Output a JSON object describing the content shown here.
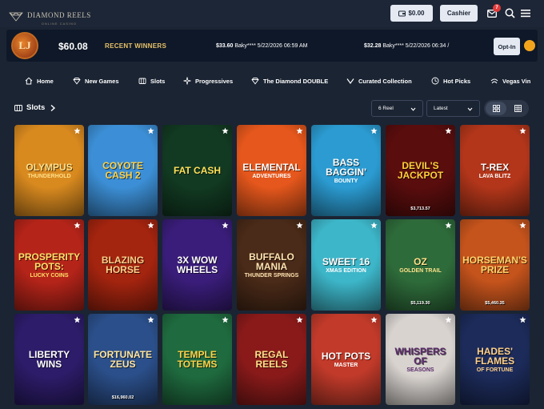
{
  "header": {
    "logo_text": "DIAMOND REELS",
    "logo_subtext": "ONLINE CASINO",
    "balance": "$0.00",
    "cashier_label": "Cashier",
    "notifications_count": "7",
    "bg_color": "#1d2636"
  },
  "banner": {
    "logo_text": "LJ",
    "jackpot_amount": "$60.08",
    "recent_label": "RECENT WINNERS",
    "winners": [
      {
        "amount": "$33.60",
        "user": "Baky****",
        "time": "5/22/2026 06:59 AM"
      },
      {
        "amount": "$32.28",
        "user": "Baky****",
        "time": "5/22/2026 06:34 /"
      }
    ],
    "optin_label": "Opt-In"
  },
  "nav": {
    "items": [
      {
        "label": "Home",
        "icon": "home-icon"
      },
      {
        "label": "New Games",
        "icon": "diamond-icon"
      },
      {
        "label": "Slots",
        "icon": "slots-icon"
      },
      {
        "label": "Progressives",
        "icon": "sparkle-icon"
      },
      {
        "label": "The Diamond DOUBLE",
        "icon": "diamond-icon"
      },
      {
        "label": "Curated Collection",
        "icon": "chevron-icon"
      },
      {
        "label": "Hot Picks",
        "icon": "flame-icon"
      },
      {
        "label": "Vegas Vin",
        "icon": "dice-icon"
      }
    ]
  },
  "section": {
    "title": "Slots",
    "reel_filter": "6 Reel",
    "sort_filter": "Latest"
  },
  "games": [
    {
      "title": "Olympus",
      "sub": "Thunderhold",
      "jackpot": ""
    },
    {
      "title": "Coyote Cash 2",
      "sub": "",
      "jackpot": ""
    },
    {
      "title": "Fat Cash",
      "sub": "",
      "jackpot": ""
    },
    {
      "title": "Elemental",
      "sub": "Adventures",
      "jackpot": ""
    },
    {
      "title": "Bass Baggin'",
      "sub": "Bounty",
      "jackpot": ""
    },
    {
      "title": "Devil's Jackpot",
      "sub": "",
      "jackpot": "$3,713.57"
    },
    {
      "title": "T-Rex",
      "sub": "Lava Blitz",
      "jackpot": ""
    },
    {
      "title": "Prosperity Pots:",
      "sub": "Lucky Coins",
      "jackpot": ""
    },
    {
      "title": "Blazing Horse",
      "sub": "",
      "jackpot": ""
    },
    {
      "title": "3x Wow Wheels",
      "sub": "",
      "jackpot": ""
    },
    {
      "title": "Buffalo Mania",
      "sub": "Thunder Springs",
      "jackpot": ""
    },
    {
      "title": "Sweet 16",
      "sub": "Xmas Edition",
      "jackpot": ""
    },
    {
      "title": "Oz",
      "sub": "Golden Trail",
      "jackpot": "$5,119.30"
    },
    {
      "title": "Horseman's Prize",
      "sub": "",
      "jackpot": "$5,460.35"
    },
    {
      "title": "Liberty Wins",
      "sub": "",
      "jackpot": ""
    },
    {
      "title": "Fortunate Zeus",
      "sub": "",
      "jackpot": "$16,960.02"
    },
    {
      "title": "Temple Totems",
      "sub": "",
      "jackpot": ""
    },
    {
      "title": "Regal Reels",
      "sub": "",
      "jackpot": ""
    },
    {
      "title": "Hot Pots",
      "sub": "Master",
      "jackpot": ""
    },
    {
      "title": "Whispers of",
      "sub": "Seasons",
      "jackpot": ""
    },
    {
      "title": "Hades' Flames",
      "sub": "of Fortune",
      "jackpot": ""
    }
  ],
  "tile_colors": [
    "#d98a1f",
    "#3c8fd6",
    "#123a22",
    "#e5571c",
    "#2b9bd1",
    "#5a0d0d",
    "#b3361a",
    "#b52419",
    "#a3240f",
    "#3a1d7a",
    "#4a2a18",
    "#3db6c9",
    "#2e6b3a",
    "#c4531c",
    "#2d1c6a",
    "#2b4f8a",
    "#1f6b3f",
    "#8a1a1a",
    "#c13a2a",
    "#d8d3cf",
    "#1c2b5a"
  ]
}
